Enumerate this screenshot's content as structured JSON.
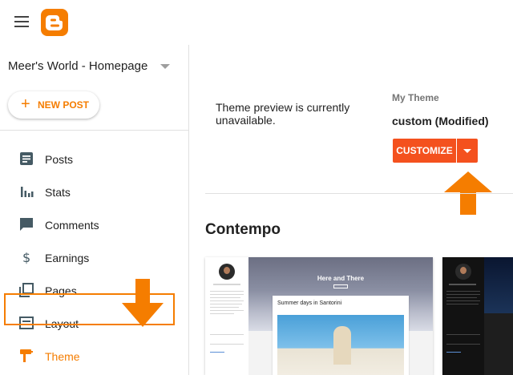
{
  "sidebar": {
    "blog_name": "Meer's World - Homepage",
    "new_post_label": "NEW POST",
    "items": [
      {
        "label": "Posts"
      },
      {
        "label": "Stats"
      },
      {
        "label": "Comments"
      },
      {
        "label": "Earnings"
      },
      {
        "label": "Pages"
      },
      {
        "label": "Layout"
      },
      {
        "label": "Theme"
      }
    ]
  },
  "main": {
    "preview_message": "Theme preview is currently unavailable.",
    "my_theme_label": "My Theme",
    "my_theme_name": "custom (Modified)",
    "customize_label": "CUSTOMIZE",
    "section_title": "Contempo",
    "thumbnails": [
      {
        "hero_title": "Here and There",
        "card_title": "Summer days in Santorini"
      }
    ]
  },
  "colors": {
    "accent": "#f57d00",
    "customize_button": "#f4511e"
  }
}
